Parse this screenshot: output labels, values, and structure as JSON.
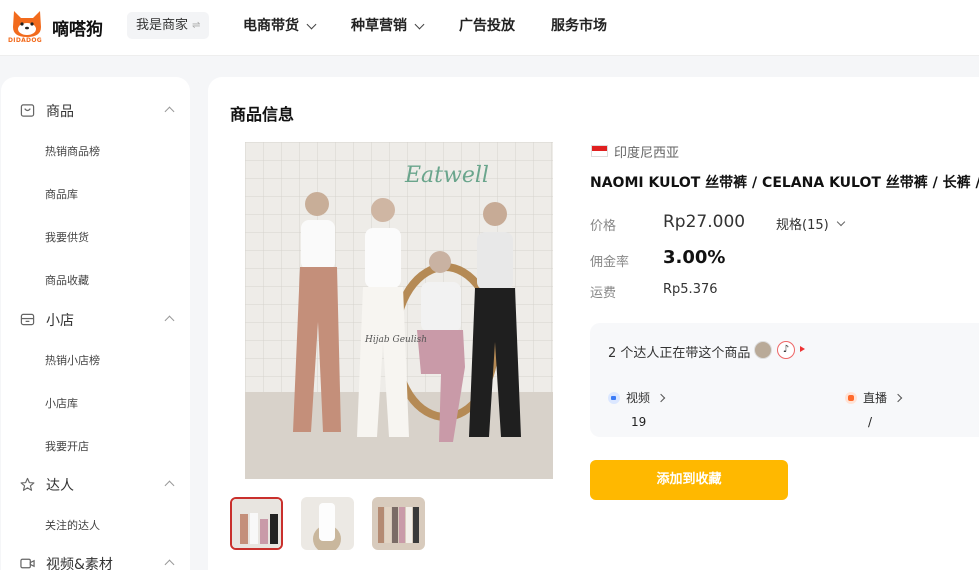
{
  "header": {
    "logo_text": "嘀嗒狗",
    "logo_subtext": "DIDADOG",
    "switch_label": "我是商家",
    "nav": [
      {
        "label": "电商带货",
        "has_dropdown": true
      },
      {
        "label": "种草营销",
        "has_dropdown": true
      },
      {
        "label": "广告投放",
        "has_dropdown": false
      },
      {
        "label": "服务市场",
        "has_dropdown": false
      }
    ]
  },
  "sidebar": {
    "groups": [
      {
        "label": "商品",
        "icon": "bag-icon",
        "items": [
          "热销商品榜",
          "商品库",
          "我要供货",
          "商品收藏"
        ]
      },
      {
        "label": "小店",
        "icon": "shop-icon",
        "items": [
          "热销小店榜",
          "小店库",
          "我要开店"
        ]
      },
      {
        "label": "达人",
        "icon": "star-icon",
        "items": [
          "关注的达人"
        ]
      },
      {
        "label": "视频&素材",
        "icon": "video-icon",
        "items": []
      }
    ]
  },
  "product": {
    "section_title": "商品信息",
    "country": "印度尼西亚",
    "name": "NAOMI KULOT 丝带裤 / CELANA KULOT 丝带裤 / 长裤 /",
    "price_label": "价格",
    "price": "Rp27.000",
    "spec_label": "规格(15)",
    "commission_label": "佣金率",
    "commission": "3.00%",
    "shipping_label": "运费",
    "shipping": "Rp5.376",
    "image_watermark": "Hijab Geulish",
    "creators": {
      "text": "2 个达人正在带这个商品",
      "video_label": "视频",
      "video_count": "19",
      "live_label": "直播",
      "live_count": "/"
    },
    "add_button": "添加到收藏"
  },
  "colors": {
    "accent": "#ffb800",
    "logo_orange": "#f26b1d",
    "flag_red": "#e02020"
  }
}
